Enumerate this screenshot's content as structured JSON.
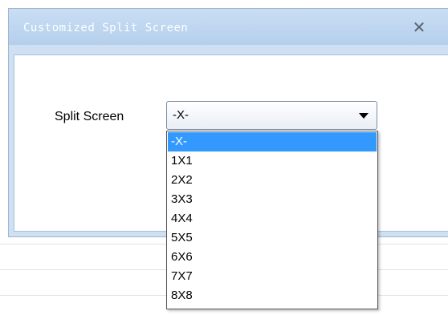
{
  "dialog": {
    "title": "Customized Split Screen",
    "close_icon": "close-icon"
  },
  "form": {
    "split_label": "Split Screen",
    "selected_value": "-X-"
  },
  "dropdown": {
    "options": [
      "-X-",
      "1X1",
      "2X2",
      "3X3",
      "4X4",
      "5X5",
      "6X6",
      "7X7",
      "8X8"
    ],
    "highlighted": "-X-",
    "highlight_color": "#3399ff"
  }
}
